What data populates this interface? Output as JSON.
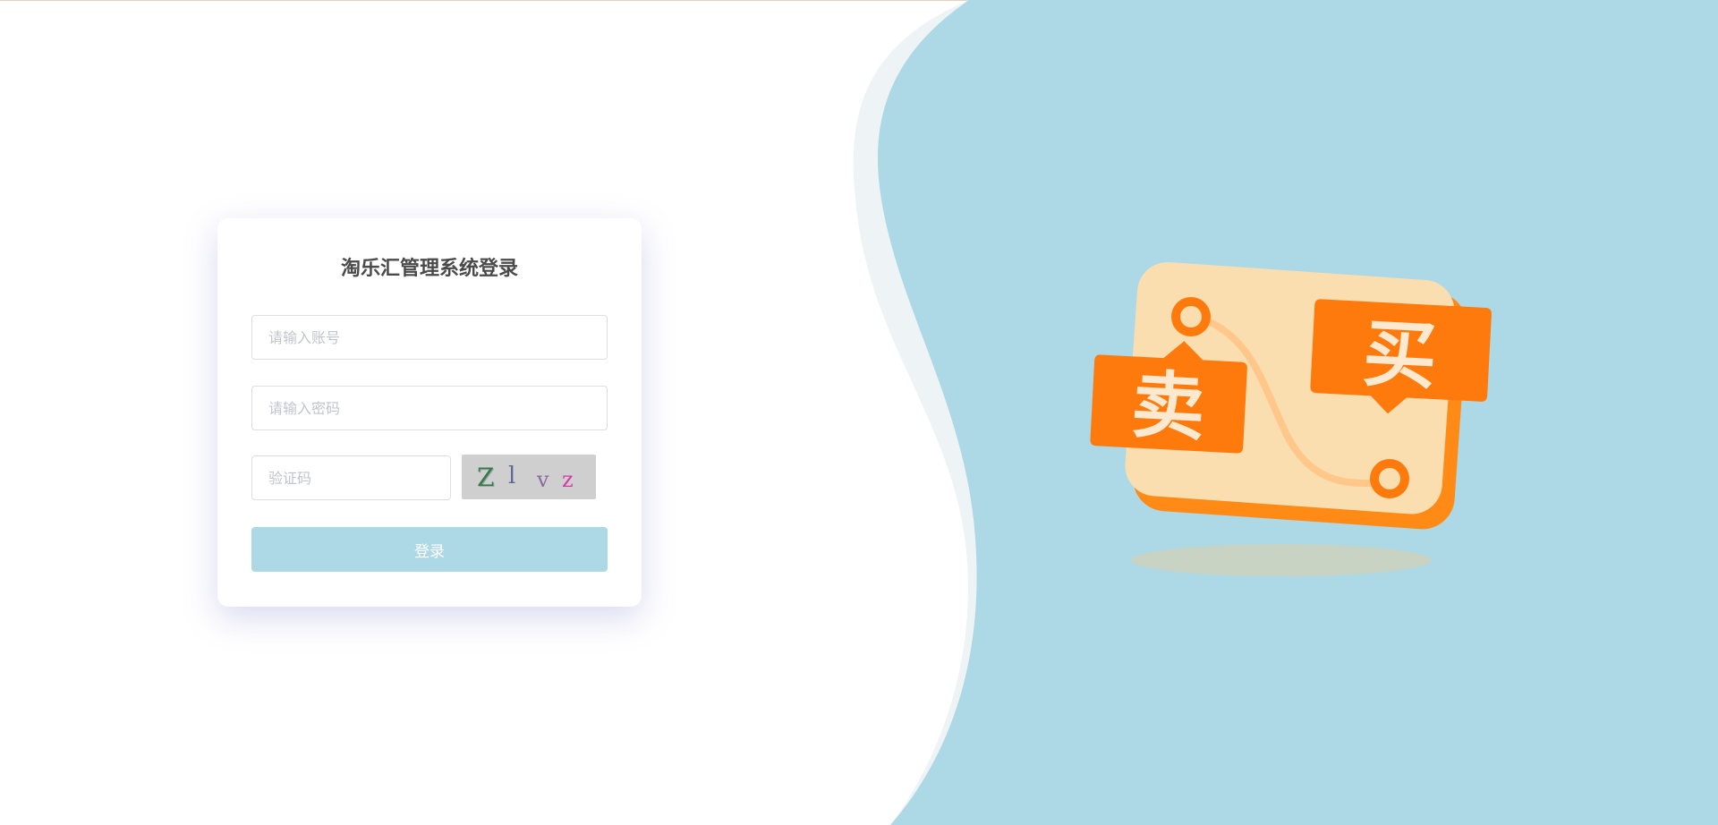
{
  "login": {
    "title": "淘乐汇管理系统登录",
    "account_placeholder": "请输入账号",
    "password_placeholder": "请输入密码",
    "captcha_placeholder": "验证码",
    "captcha_chars": [
      "Z",
      "l",
      "v",
      "z"
    ],
    "button_label": "登录"
  },
  "illustration": {
    "sell_label": "卖",
    "buy_label": "买"
  },
  "colors": {
    "panel_blue": "#add8e6",
    "wave_edge": "#eef3f6",
    "accent_orange": "#ff7a0d",
    "card_cream": "#fadeb0"
  }
}
